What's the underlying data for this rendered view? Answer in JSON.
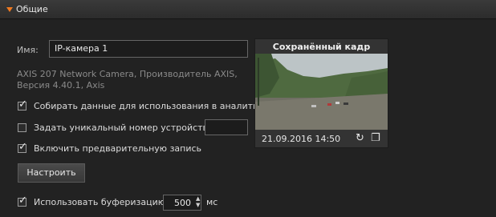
{
  "header": {
    "title": "Общие"
  },
  "form": {
    "name_label": "Имя:",
    "name_value": "IP-камера 1",
    "device_info_line1": "AXIS 207 Network Camera, Производитель AXIS,",
    "device_info_line2": "Версия 4.40.1, Axis",
    "collect_analytics": {
      "label": "Собирать данные для использования в аналитике",
      "checked": true
    },
    "unique_number": {
      "label": "Задать уникальный номер устройства",
      "checked": false,
      "value": ""
    },
    "prerecord": {
      "label": "Включить предварительную запись",
      "checked": true
    },
    "configure_button": "Настроить",
    "buffering": {
      "label": "Использовать буферизацию",
      "checked": true,
      "value": "500",
      "unit": "мс"
    }
  },
  "snapshot": {
    "title": "Сохранённый кадр",
    "timestamp": "21.09.2016 14:50",
    "refresh_icon": "refresh-icon",
    "window_icon": "window-icon"
  }
}
